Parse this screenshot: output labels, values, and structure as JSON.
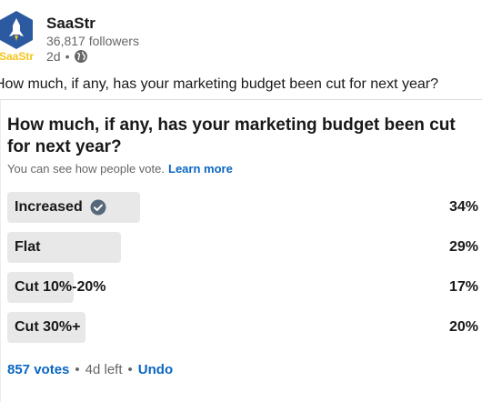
{
  "author": {
    "name": "SaaStr",
    "followers": "36,817 followers",
    "time": "2d",
    "dot": "•",
    "logo_text": "SaaStr",
    "visibility_icon": "globe-icon"
  },
  "post_text": "How much, if any, has your marketing budget been cut for next year?",
  "poll": {
    "question": "How much, if any, has your marketing budget been cut for next year?",
    "visibility_text": "You can see how people vote.",
    "learn_more": "Learn more",
    "options": [
      {
        "label": "Increased",
        "percent": "34%",
        "value": 0.34,
        "selected": true,
        "icon": "check-circle-icon"
      },
      {
        "label": "Flat",
        "percent": "29%",
        "value": 0.29,
        "selected": false
      },
      {
        "label": "Cut 10%-20%",
        "percent": "17%",
        "value": 0.17,
        "selected": false
      },
      {
        "label": "Cut 30%+",
        "percent": "20%",
        "value": 0.2,
        "selected": false
      }
    ],
    "votes": "857 votes",
    "separator": "•",
    "time_left": "4d left",
    "undo": "Undo"
  },
  "colors": {
    "link": "#0a66c2",
    "bar": "#e8e8e8",
    "logo_blue": "#2c5aa0",
    "logo_yellow": "#f5c518"
  }
}
